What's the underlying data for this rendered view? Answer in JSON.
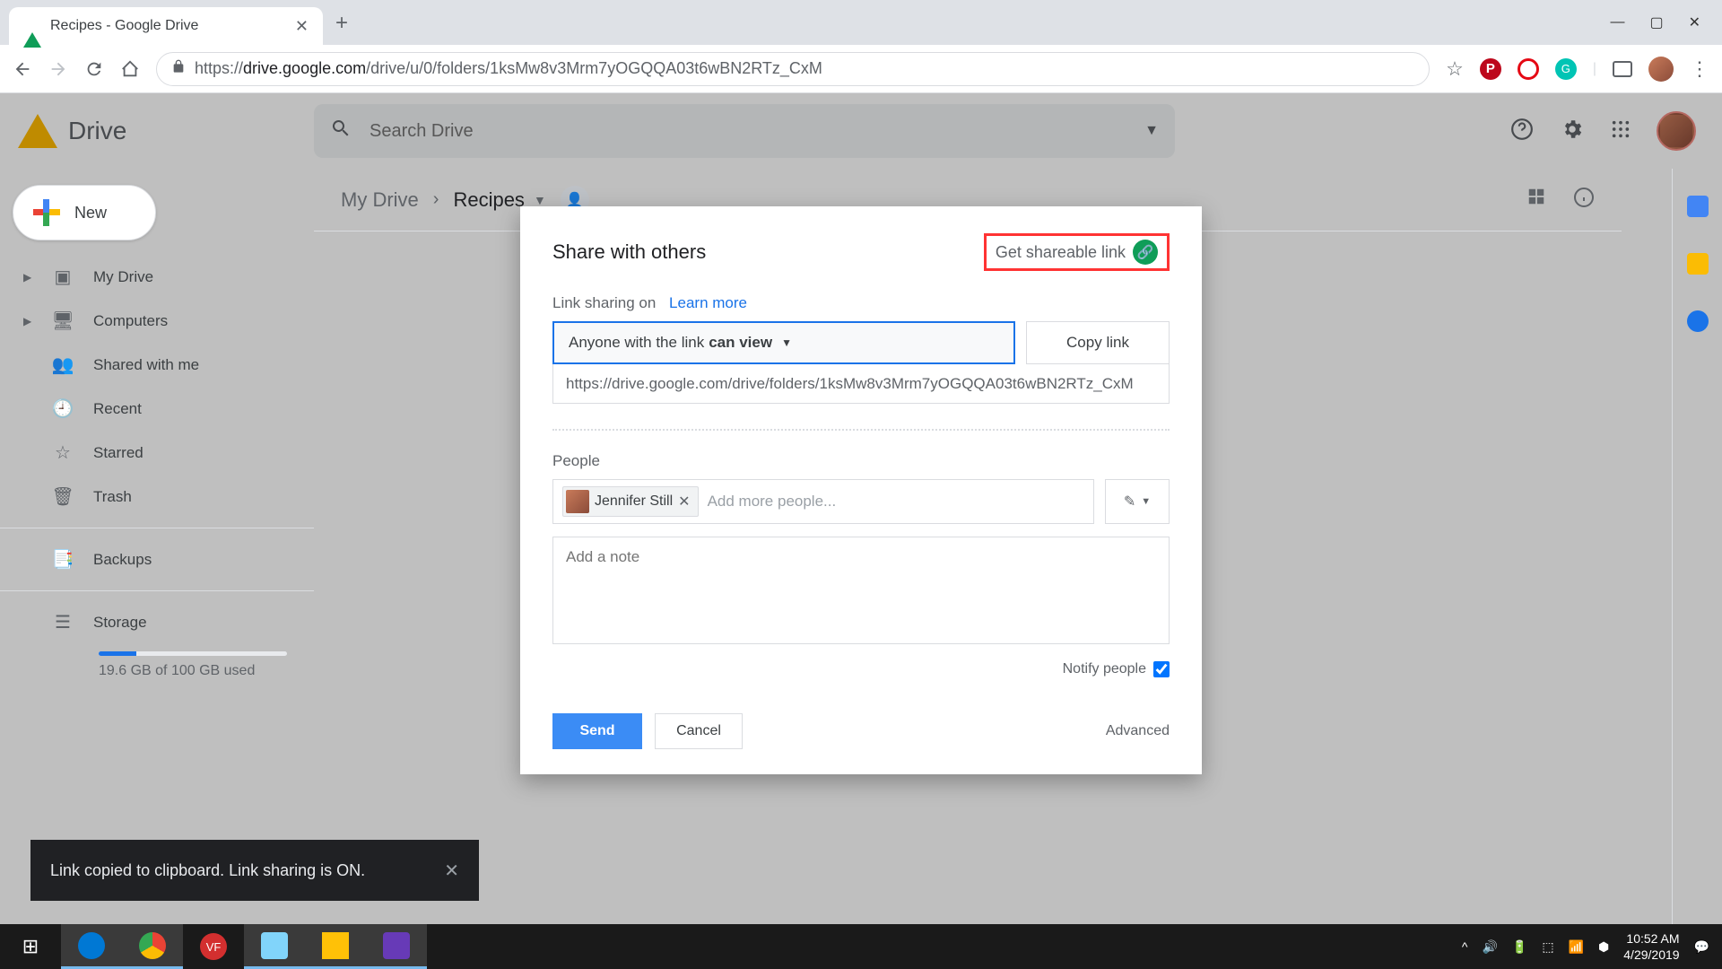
{
  "browser": {
    "tab_title": "Recipes - Google Drive",
    "url_prefix": "https://",
    "url_host": "drive.google.com",
    "url_path": "/drive/u/0/folders/1ksMw8v3Mrm7yOGQQA03t6wBN2RTz_CxM"
  },
  "drive": {
    "product": "Drive",
    "search_placeholder": "Search Drive",
    "new_label": "New",
    "sidebar": [
      {
        "label": "My Drive",
        "icon": "▣",
        "expandable": true
      },
      {
        "label": "Computers",
        "icon": "🖥",
        "expandable": true
      },
      {
        "label": "Shared with me",
        "icon": "👥",
        "expandable": false
      },
      {
        "label": "Recent",
        "icon": "🕘",
        "expandable": false
      },
      {
        "label": "Starred",
        "icon": "☆",
        "expandable": false
      },
      {
        "label": "Trash",
        "icon": "🗑",
        "expandable": false
      }
    ],
    "backups": {
      "label": "Backups",
      "icon": "📑"
    },
    "storage": {
      "label": "Storage",
      "used_text": "19.6 GB of 100 GB used",
      "pct": 20
    }
  },
  "breadcrumb": {
    "root": "My Drive",
    "current": "Recipes"
  },
  "dialog": {
    "title": "Share with others",
    "get_link": "Get shareable link",
    "sharing_on": "Link sharing on",
    "learn_more": "Learn more",
    "anyone_prefix": "Anyone with the link",
    "anyone_perm": "can view",
    "copy_link": "Copy link",
    "link_url": "https://drive.google.com/drive/folders/1ksMw8v3Mrm7yOGQQA03t6wBN2RTz_CxM",
    "people_label": "People",
    "person": "Jennifer Still",
    "add_more": "Add more people...",
    "note_placeholder": "Add a note",
    "notify": "Notify people",
    "send": "Send",
    "cancel": "Cancel",
    "advanced": "Advanced"
  },
  "toast": {
    "text": "Link copied to clipboard. Link sharing is ON."
  },
  "system": {
    "time": "10:52 AM",
    "date": "4/29/2019"
  }
}
